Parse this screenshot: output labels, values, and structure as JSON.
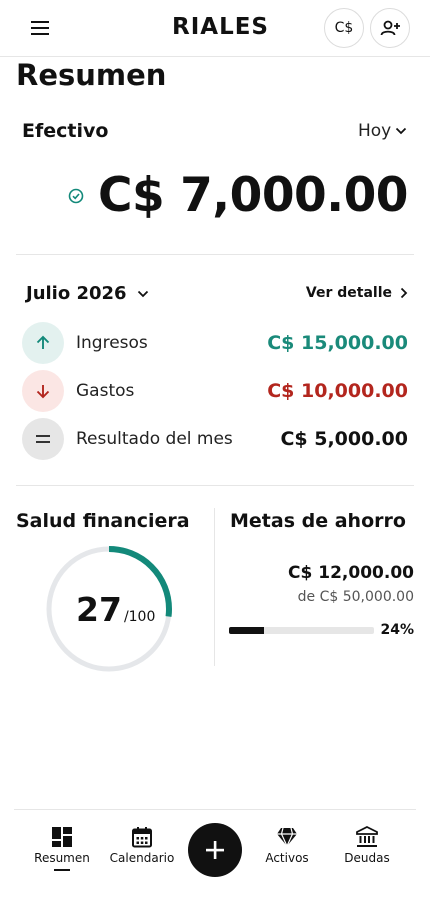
{
  "header": {
    "logo": "RIALES",
    "currency_button": "C$"
  },
  "page_title": "Resumen",
  "cash": {
    "label": "Efectivo",
    "period": "Hoy",
    "balance": "C$ 7,000.00"
  },
  "month": {
    "label": "Julio 2026",
    "detail_link": "Ver detalle"
  },
  "summary_rows": [
    {
      "label": "Ingresos",
      "amount": "C$ 15,000.00",
      "color": "#1a8a7a"
    },
    {
      "label": "Gastos",
      "amount": "C$ 10,000.00",
      "color": "#b3261e"
    },
    {
      "label": "Resultado del mes",
      "amount": "C$ 5,000.00",
      "color": "#111111"
    }
  ],
  "health": {
    "title": "Salud financiera",
    "score": "27",
    "max": "/100",
    "score_value": 27,
    "gauge_color": "#13897a"
  },
  "savings": {
    "title": "Metas de ahorro",
    "amount": "C$ 12,000.00",
    "goal": "de C$ 50,000.00",
    "percent": "24%",
    "progress": 0.24
  },
  "bottom_nav": {
    "items": [
      {
        "label": "Resumen",
        "icon": "dashboard-icon",
        "active": true
      },
      {
        "label": "Calendario",
        "icon": "calendar-icon"
      },
      {
        "label": "Activos",
        "icon": "diamond-icon"
      },
      {
        "label": "Deudas",
        "icon": "bank-icon"
      }
    ],
    "fab_icon": "plus-icon"
  }
}
